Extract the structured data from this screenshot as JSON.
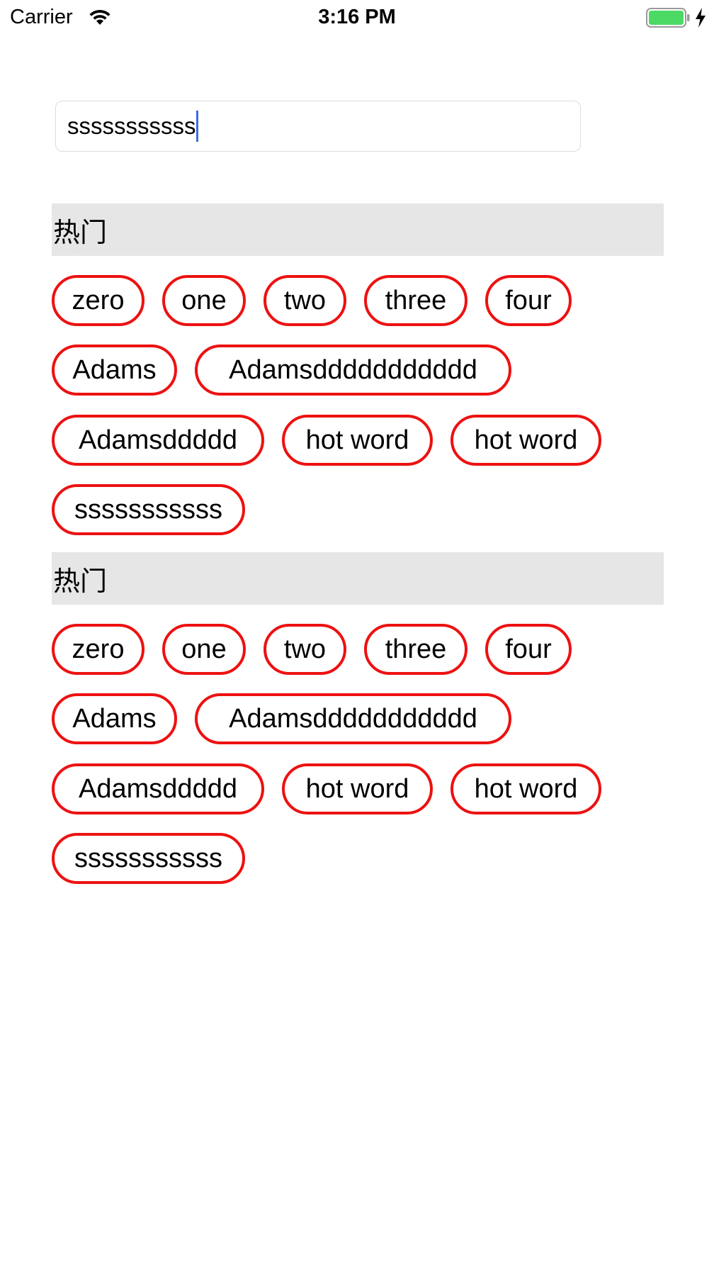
{
  "status_bar": {
    "carrier": "Carrier",
    "time": "3:16 PM",
    "battery_color": "#4cd964",
    "icons": [
      "wifi-icon",
      "battery-icon",
      "charging-bolt-icon"
    ]
  },
  "search": {
    "value": "sssssssssss",
    "caret_color": "#3f6be0"
  },
  "tag_border_color": "#ee1111",
  "sections": [
    {
      "title": "热门",
      "tags": [
        "zero",
        "one",
        "two",
        "three",
        "four",
        "Adams",
        "Adamsddddddddddd",
        "Adamsddddd",
        "hot word",
        "hot word",
        "sssssssssss"
      ]
    },
    {
      "title": "热门",
      "tags": [
        "zero",
        "one",
        "two",
        "three",
        "four",
        "Adams",
        "Adamsddddddddddd",
        "Adamsddddd",
        "hot word",
        "hot word",
        "sssssssssss"
      ]
    }
  ]
}
